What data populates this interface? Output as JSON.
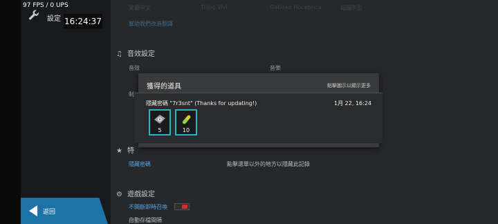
{
  "status": {
    "fps": "97 FPS / 0 UPS",
    "clock": "16:24:37"
  },
  "sidebar": {
    "title": "設定",
    "back_label": "返回"
  },
  "top_row": {
    "link": "幫助我們改進翻譯",
    "item1": "繁體中文",
    "item2": "Tiling Vivi",
    "item3": "Gabiske Hocebrica",
    "item4": "超過字型"
  },
  "sections": {
    "audio": {
      "title": "音效設定",
      "sfx_label": "音效",
      "music_label": "音樂",
      "production_label": "制"
    },
    "special": {
      "title": "特",
      "hidden_code_link": "隱藏密碼",
      "hint": "點擊選單以外的地方以隱藏此記錄",
      "partial": "記錄"
    },
    "game": {
      "title": "遊戲設定",
      "always_online": "不間斷即時召喚",
      "autosave": "自動存檔間隔"
    }
  },
  "dialog": {
    "title": "獲得的道具",
    "hint": "點擊圖示以顯示更多",
    "entry": {
      "name": "隱藏密碼 \"7r3snt\" (Thanks for updating!)",
      "time": "1月 22, 16:24",
      "items": [
        {
          "icon": "gear-ticket-icon",
          "count": "5"
        },
        {
          "icon": "gold-capsule-icon",
          "count": "10"
        }
      ]
    }
  },
  "colors": {
    "accent": "#1d72a8",
    "item_border": "#2ab3c8",
    "link": "#5aa6dd"
  }
}
